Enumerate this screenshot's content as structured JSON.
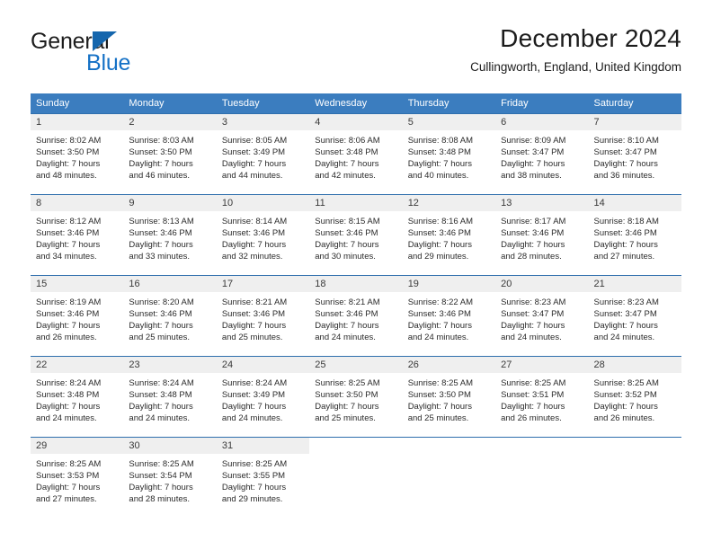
{
  "logo": {
    "word_one": "General",
    "word_two": "Blue",
    "triangle_icon": "blue-triangle-icon",
    "blue": "#1571c6",
    "dark": "#1c1c1c"
  },
  "header": {
    "title": "December 2024",
    "subtitle": "Cullingworth, England, United Kingdom"
  },
  "theme": {
    "header_blue": "#3b7dbf",
    "rule_blue": "#2f6fad",
    "daynum_band": "#efefef",
    "text": "#2b2b2b"
  },
  "weekdays": [
    "Sunday",
    "Monday",
    "Tuesday",
    "Wednesday",
    "Thursday",
    "Friday",
    "Saturday"
  ],
  "weeks": [
    [
      {
        "day": "1",
        "sunrise": "Sunrise: 8:02 AM",
        "sunset": "Sunset: 3:50 PM",
        "daylight1": "Daylight: 7 hours",
        "daylight2": "and 48 minutes."
      },
      {
        "day": "2",
        "sunrise": "Sunrise: 8:03 AM",
        "sunset": "Sunset: 3:50 PM",
        "daylight1": "Daylight: 7 hours",
        "daylight2": "and 46 minutes."
      },
      {
        "day": "3",
        "sunrise": "Sunrise: 8:05 AM",
        "sunset": "Sunset: 3:49 PM",
        "daylight1": "Daylight: 7 hours",
        "daylight2": "and 44 minutes."
      },
      {
        "day": "4",
        "sunrise": "Sunrise: 8:06 AM",
        "sunset": "Sunset: 3:48 PM",
        "daylight1": "Daylight: 7 hours",
        "daylight2": "and 42 minutes."
      },
      {
        "day": "5",
        "sunrise": "Sunrise: 8:08 AM",
        "sunset": "Sunset: 3:48 PM",
        "daylight1": "Daylight: 7 hours",
        "daylight2": "and 40 minutes."
      },
      {
        "day": "6",
        "sunrise": "Sunrise: 8:09 AM",
        "sunset": "Sunset: 3:47 PM",
        "daylight1": "Daylight: 7 hours",
        "daylight2": "and 38 minutes."
      },
      {
        "day": "7",
        "sunrise": "Sunrise: 8:10 AM",
        "sunset": "Sunset: 3:47 PM",
        "daylight1": "Daylight: 7 hours",
        "daylight2": "and 36 minutes."
      }
    ],
    [
      {
        "day": "8",
        "sunrise": "Sunrise: 8:12 AM",
        "sunset": "Sunset: 3:46 PM",
        "daylight1": "Daylight: 7 hours",
        "daylight2": "and 34 minutes."
      },
      {
        "day": "9",
        "sunrise": "Sunrise: 8:13 AM",
        "sunset": "Sunset: 3:46 PM",
        "daylight1": "Daylight: 7 hours",
        "daylight2": "and 33 minutes."
      },
      {
        "day": "10",
        "sunrise": "Sunrise: 8:14 AM",
        "sunset": "Sunset: 3:46 PM",
        "daylight1": "Daylight: 7 hours",
        "daylight2": "and 32 minutes."
      },
      {
        "day": "11",
        "sunrise": "Sunrise: 8:15 AM",
        "sunset": "Sunset: 3:46 PM",
        "daylight1": "Daylight: 7 hours",
        "daylight2": "and 30 minutes."
      },
      {
        "day": "12",
        "sunrise": "Sunrise: 8:16 AM",
        "sunset": "Sunset: 3:46 PM",
        "daylight1": "Daylight: 7 hours",
        "daylight2": "and 29 minutes."
      },
      {
        "day": "13",
        "sunrise": "Sunrise: 8:17 AM",
        "sunset": "Sunset: 3:46 PM",
        "daylight1": "Daylight: 7 hours",
        "daylight2": "and 28 minutes."
      },
      {
        "day": "14",
        "sunrise": "Sunrise: 8:18 AM",
        "sunset": "Sunset: 3:46 PM",
        "daylight1": "Daylight: 7 hours",
        "daylight2": "and 27 minutes."
      }
    ],
    [
      {
        "day": "15",
        "sunrise": "Sunrise: 8:19 AM",
        "sunset": "Sunset: 3:46 PM",
        "daylight1": "Daylight: 7 hours",
        "daylight2": "and 26 minutes."
      },
      {
        "day": "16",
        "sunrise": "Sunrise: 8:20 AM",
        "sunset": "Sunset: 3:46 PM",
        "daylight1": "Daylight: 7 hours",
        "daylight2": "and 25 minutes."
      },
      {
        "day": "17",
        "sunrise": "Sunrise: 8:21 AM",
        "sunset": "Sunset: 3:46 PM",
        "daylight1": "Daylight: 7 hours",
        "daylight2": "and 25 minutes."
      },
      {
        "day": "18",
        "sunrise": "Sunrise: 8:21 AM",
        "sunset": "Sunset: 3:46 PM",
        "daylight1": "Daylight: 7 hours",
        "daylight2": "and 24 minutes."
      },
      {
        "day": "19",
        "sunrise": "Sunrise: 8:22 AM",
        "sunset": "Sunset: 3:46 PM",
        "daylight1": "Daylight: 7 hours",
        "daylight2": "and 24 minutes."
      },
      {
        "day": "20",
        "sunrise": "Sunrise: 8:23 AM",
        "sunset": "Sunset: 3:47 PM",
        "daylight1": "Daylight: 7 hours",
        "daylight2": "and 24 minutes."
      },
      {
        "day": "21",
        "sunrise": "Sunrise: 8:23 AM",
        "sunset": "Sunset: 3:47 PM",
        "daylight1": "Daylight: 7 hours",
        "daylight2": "and 24 minutes."
      }
    ],
    [
      {
        "day": "22",
        "sunrise": "Sunrise: 8:24 AM",
        "sunset": "Sunset: 3:48 PM",
        "daylight1": "Daylight: 7 hours",
        "daylight2": "and 24 minutes."
      },
      {
        "day": "23",
        "sunrise": "Sunrise: 8:24 AM",
        "sunset": "Sunset: 3:48 PM",
        "daylight1": "Daylight: 7 hours",
        "daylight2": "and 24 minutes."
      },
      {
        "day": "24",
        "sunrise": "Sunrise: 8:24 AM",
        "sunset": "Sunset: 3:49 PM",
        "daylight1": "Daylight: 7 hours",
        "daylight2": "and 24 minutes."
      },
      {
        "day": "25",
        "sunrise": "Sunrise: 8:25 AM",
        "sunset": "Sunset: 3:50 PM",
        "daylight1": "Daylight: 7 hours",
        "daylight2": "and 25 minutes."
      },
      {
        "day": "26",
        "sunrise": "Sunrise: 8:25 AM",
        "sunset": "Sunset: 3:50 PM",
        "daylight1": "Daylight: 7 hours",
        "daylight2": "and 25 minutes."
      },
      {
        "day": "27",
        "sunrise": "Sunrise: 8:25 AM",
        "sunset": "Sunset: 3:51 PM",
        "daylight1": "Daylight: 7 hours",
        "daylight2": "and 26 minutes."
      },
      {
        "day": "28",
        "sunrise": "Sunrise: 8:25 AM",
        "sunset": "Sunset: 3:52 PM",
        "daylight1": "Daylight: 7 hours",
        "daylight2": "and 26 minutes."
      }
    ],
    [
      {
        "day": "29",
        "sunrise": "Sunrise: 8:25 AM",
        "sunset": "Sunset: 3:53 PM",
        "daylight1": "Daylight: 7 hours",
        "daylight2": "and 27 minutes."
      },
      {
        "day": "30",
        "sunrise": "Sunrise: 8:25 AM",
        "sunset": "Sunset: 3:54 PM",
        "daylight1": "Daylight: 7 hours",
        "daylight2": "and 28 minutes."
      },
      {
        "day": "31",
        "sunrise": "Sunrise: 8:25 AM",
        "sunset": "Sunset: 3:55 PM",
        "daylight1": "Daylight: 7 hours",
        "daylight2": "and 29 minutes."
      },
      {
        "day": "",
        "sunrise": "",
        "sunset": "",
        "daylight1": "",
        "daylight2": ""
      },
      {
        "day": "",
        "sunrise": "",
        "sunset": "",
        "daylight1": "",
        "daylight2": ""
      },
      {
        "day": "",
        "sunrise": "",
        "sunset": "",
        "daylight1": "",
        "daylight2": ""
      },
      {
        "day": "",
        "sunrise": "",
        "sunset": "",
        "daylight1": "",
        "daylight2": ""
      }
    ]
  ]
}
